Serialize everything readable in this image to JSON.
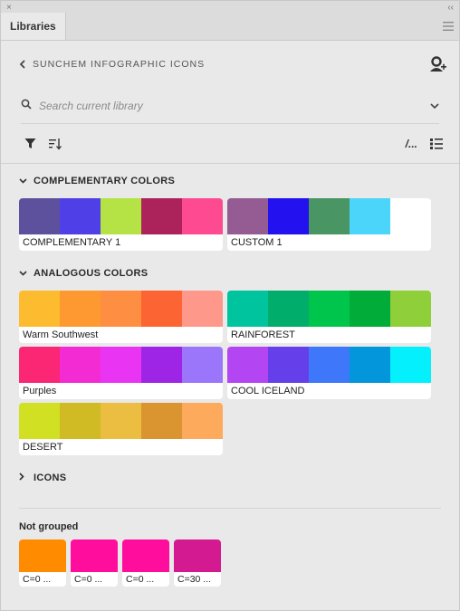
{
  "window": {
    "close_glyph": "×",
    "collapse_glyph": "‹‹"
  },
  "tabs": [
    {
      "label": "Libraries"
    }
  ],
  "header": {
    "back_label": "SUNCHEM INFOGRAPHIC ICONS",
    "user_icon": "user-add-icon"
  },
  "search": {
    "placeholder": "Search current library"
  },
  "toolbar": {
    "list_view_text": "/...",
    "icons": [
      "filter-icon",
      "sort-icon",
      "list-view-icon",
      "grid-view-icon"
    ]
  },
  "sections": [
    {
      "title": "COMPLEMENTARY COLORS",
      "expanded": true,
      "themes": [
        {
          "name": "COMPLEMENTARY 1",
          "colors": [
            "#5d519e",
            "#4e3fe6",
            "#b5e345",
            "#ac235b",
            "#fd4a91"
          ]
        },
        {
          "name": "CUSTOM 1",
          "colors": [
            "#955c93",
            "#2311f0",
            "#4a9564",
            "#4cd5fb"
          ]
        }
      ]
    },
    {
      "title": "ANALOGOUS COLORS",
      "expanded": true,
      "themes": [
        {
          "name": "Warm Southwest",
          "colors": [
            "#fdbb2f",
            "#fd9930",
            "#fe8f42",
            "#fd6433",
            "#fe988b"
          ]
        },
        {
          "name": "RAINFOREST",
          "colors": [
            "#00c49e",
            "#00ad6b",
            "#00c54d",
            "#02ac38",
            "#8fcf3a"
          ]
        },
        {
          "name": "Purples",
          "colors": [
            "#fb2774",
            "#f22bd2",
            "#e935f3",
            "#9f25e6",
            "#9c76fa"
          ]
        },
        {
          "name": "COOL ICELAND",
          "colors": [
            "#b445f3",
            "#6540ea",
            "#3e77fa",
            "#0496db",
            "#05f0fd"
          ]
        },
        {
          "name": "DESERT",
          "colors": [
            "#d1e023",
            "#d1bb24",
            "#ebbd41",
            "#db9530",
            "#fdaa5d"
          ]
        }
      ]
    },
    {
      "title": "ICONS",
      "expanded": false,
      "themes": []
    }
  ],
  "not_grouped": {
    "title": "Not grouped",
    "items": [
      {
        "label": "C=0 ...",
        "color": "#ff8c00"
      },
      {
        "label": "C=0 ...",
        "color": "#ff0d9d"
      },
      {
        "label": "C=0 ...",
        "color": "#ff0d9d"
      },
      {
        "label": "C=30 ...",
        "color": "#d41a90"
      }
    ]
  }
}
